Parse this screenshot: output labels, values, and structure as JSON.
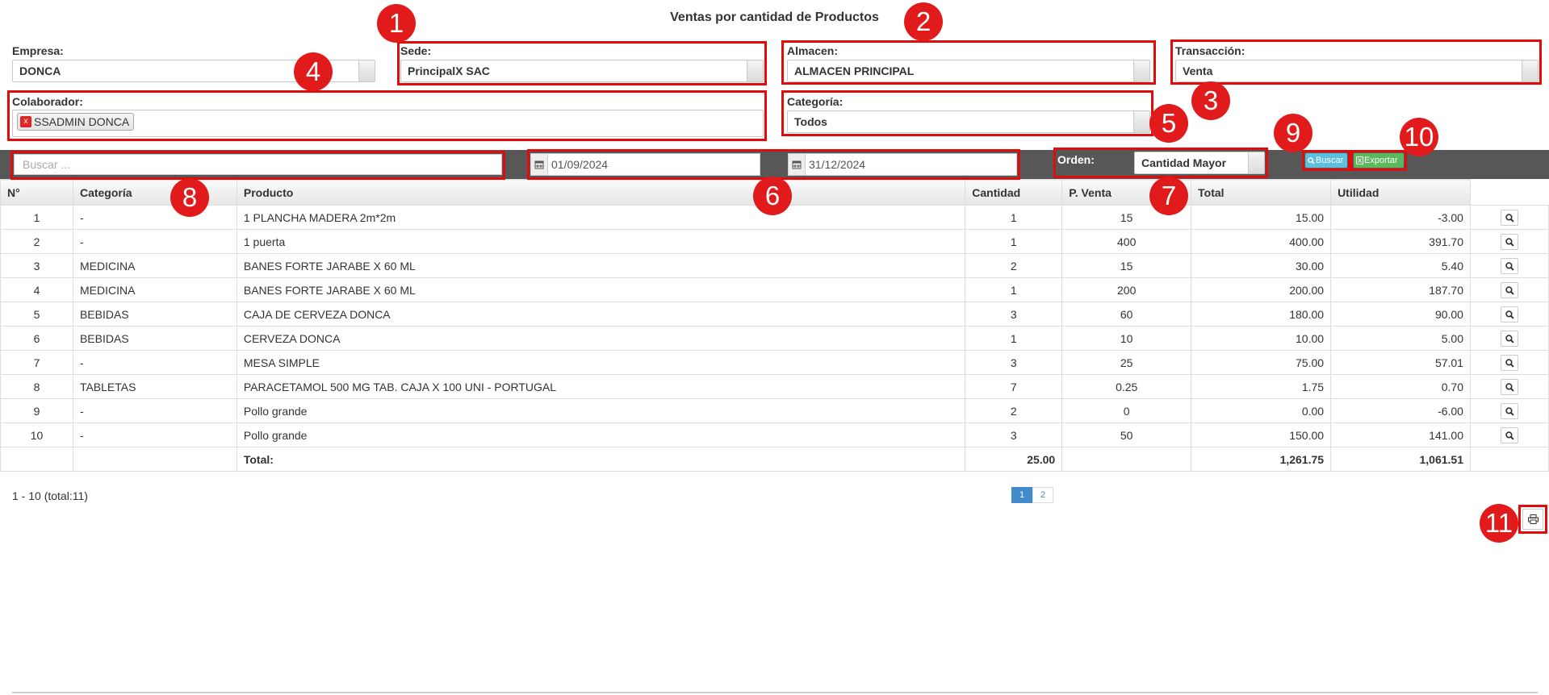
{
  "title": "Ventas por cantidad de Productos",
  "filters": {
    "empresa": {
      "label": "Empresa:",
      "value": "DONCA"
    },
    "sede": {
      "label": "Sede:",
      "value": "PrincipalX SAC"
    },
    "almacen": {
      "label": "Almacen:",
      "value": "ALMACEN PRINCIPAL"
    },
    "transaccion": {
      "label": "Transacción:",
      "value": "Venta"
    },
    "colaborador": {
      "label": "Colaborador:",
      "tag": "SSADMIN DONCA",
      "tag_remove": "x"
    },
    "categoria": {
      "label": "Categoría:",
      "value": "Todos"
    }
  },
  "toolbar": {
    "search_placeholder": "Buscar ...",
    "date_from": "01/09/2024",
    "date_to": "31/12/2024",
    "orden_label": "Orden:",
    "orden_value": "Cantidad Mayor",
    "buscar_label": "Buscar",
    "exportar_label": "Exportar"
  },
  "table": {
    "headers": [
      "N°",
      "Categoría",
      "Producto",
      "Cantidad",
      "P. Venta",
      "Total",
      "Utilidad",
      ""
    ],
    "rows": [
      [
        "1",
        "-",
        "1 PLANCHA MADERA 2m*2m",
        "1",
        "15",
        "15.00",
        "-3.00"
      ],
      [
        "2",
        "-",
        "1 puerta",
        "1",
        "400",
        "400.00",
        "391.70"
      ],
      [
        "3",
        "MEDICINA",
        "BANES FORTE JARABE X 60 ML",
        "2",
        "15",
        "30.00",
        "5.40"
      ],
      [
        "4",
        "MEDICINA",
        "BANES FORTE JARABE X 60 ML",
        "1",
        "200",
        "200.00",
        "187.70"
      ],
      [
        "5",
        "BEBIDAS",
        "CAJA DE CERVEZA DONCA",
        "3",
        "60",
        "180.00",
        "90.00"
      ],
      [
        "6",
        "BEBIDAS",
        "CERVEZA DONCA",
        "1",
        "10",
        "10.00",
        "5.00"
      ],
      [
        "7",
        "-",
        "MESA SIMPLE",
        "3",
        "25",
        "75.00",
        "57.01"
      ],
      [
        "8",
        "TABLETAS",
        "PARACETAMOL 500 MG TAB. CAJA X 100 UNI - PORTUGAL",
        "7",
        "0.25",
        "1.75",
        "0.70"
      ],
      [
        "9",
        "-",
        "Pollo grande",
        "2",
        "0",
        "0.00",
        "-6.00"
      ],
      [
        "10",
        "-",
        "Pollo grande",
        "3",
        "50",
        "150.00",
        "141.00"
      ]
    ],
    "total_label": "Total:",
    "total_cantidad": "25.00",
    "total_total": "1,261.75",
    "total_utilidad": "1,061.51"
  },
  "pagination": {
    "summary": "1 - 10 (total:11)",
    "pages": [
      "1",
      "2"
    ],
    "active_page": "1"
  },
  "markers": [
    "1",
    "2",
    "3",
    "4",
    "5",
    "6",
    "7",
    "8",
    "9",
    "10",
    "11"
  ],
  "colors": {
    "marker": "#e11b1b",
    "toolbar": "#575757",
    "buscar": "#5bc0de",
    "exportar": "#5cb85c",
    "active_page": "#428bca"
  },
  "icons": [
    "calendar-icon",
    "search-icon",
    "excel-icon",
    "zoom-icon",
    "print-icon",
    "remove-tag-icon"
  ]
}
